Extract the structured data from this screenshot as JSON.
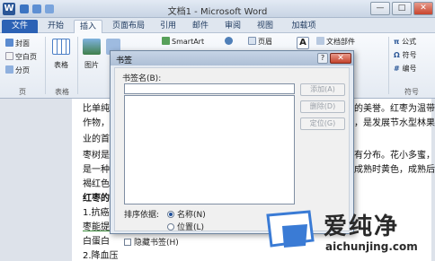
{
  "titlebar": {
    "logo": "W",
    "title": "文档1 - Microsoft Word",
    "minimize": "—",
    "maximize": "□",
    "close": "✕"
  },
  "tabs": [
    "文件",
    "开始",
    "插入",
    "页面布局",
    "引用",
    "邮件",
    "审阅",
    "视图",
    "加载项"
  ],
  "ribbon": {
    "cover_page": "封面",
    "blank_page": "空白页",
    "page_break": "分页",
    "pages_group": "页",
    "table": "表格",
    "table_group": "表格",
    "picture": "图片",
    "smartart": "SmartArt",
    "header": "页眉",
    "doc_parts": "文档部件",
    "formula": "公式",
    "symbol": "符号",
    "numbering": "编号",
    "symbol_group": "符号"
  },
  "document": {
    "lines": [
      "比单纯吃",
      "作物，",
      "业的首选",
      "枣树是一",
      "是一种",
      "褐红色，",
      "红枣的",
      "1.抗癌",
      "枣能提高",
      "白蛋白",
      "2.降血压"
    ],
    "right_lines": [
      "的美誉。红枣为温带",
      "，是发展节水型林果",
      "有分布。花小多蜜，",
      "成熟时黄色，成熟后"
    ]
  },
  "dialog": {
    "title": "书签",
    "help": "?",
    "close": "✕",
    "bookmark_name_label": "书签名(B):",
    "bookmark_name_value": "",
    "add_button": "添加(A)",
    "delete_button": "删除(D)",
    "goto_button": "定位(G)",
    "sort_label": "排序依据:",
    "sort_by_name": "名称(N)",
    "sort_by_location": "位置(L)",
    "hidden_bookmarks": "隐藏书签(H)"
  },
  "watermark": {
    "name": "爱纯净",
    "url": "aichunjing.com"
  }
}
